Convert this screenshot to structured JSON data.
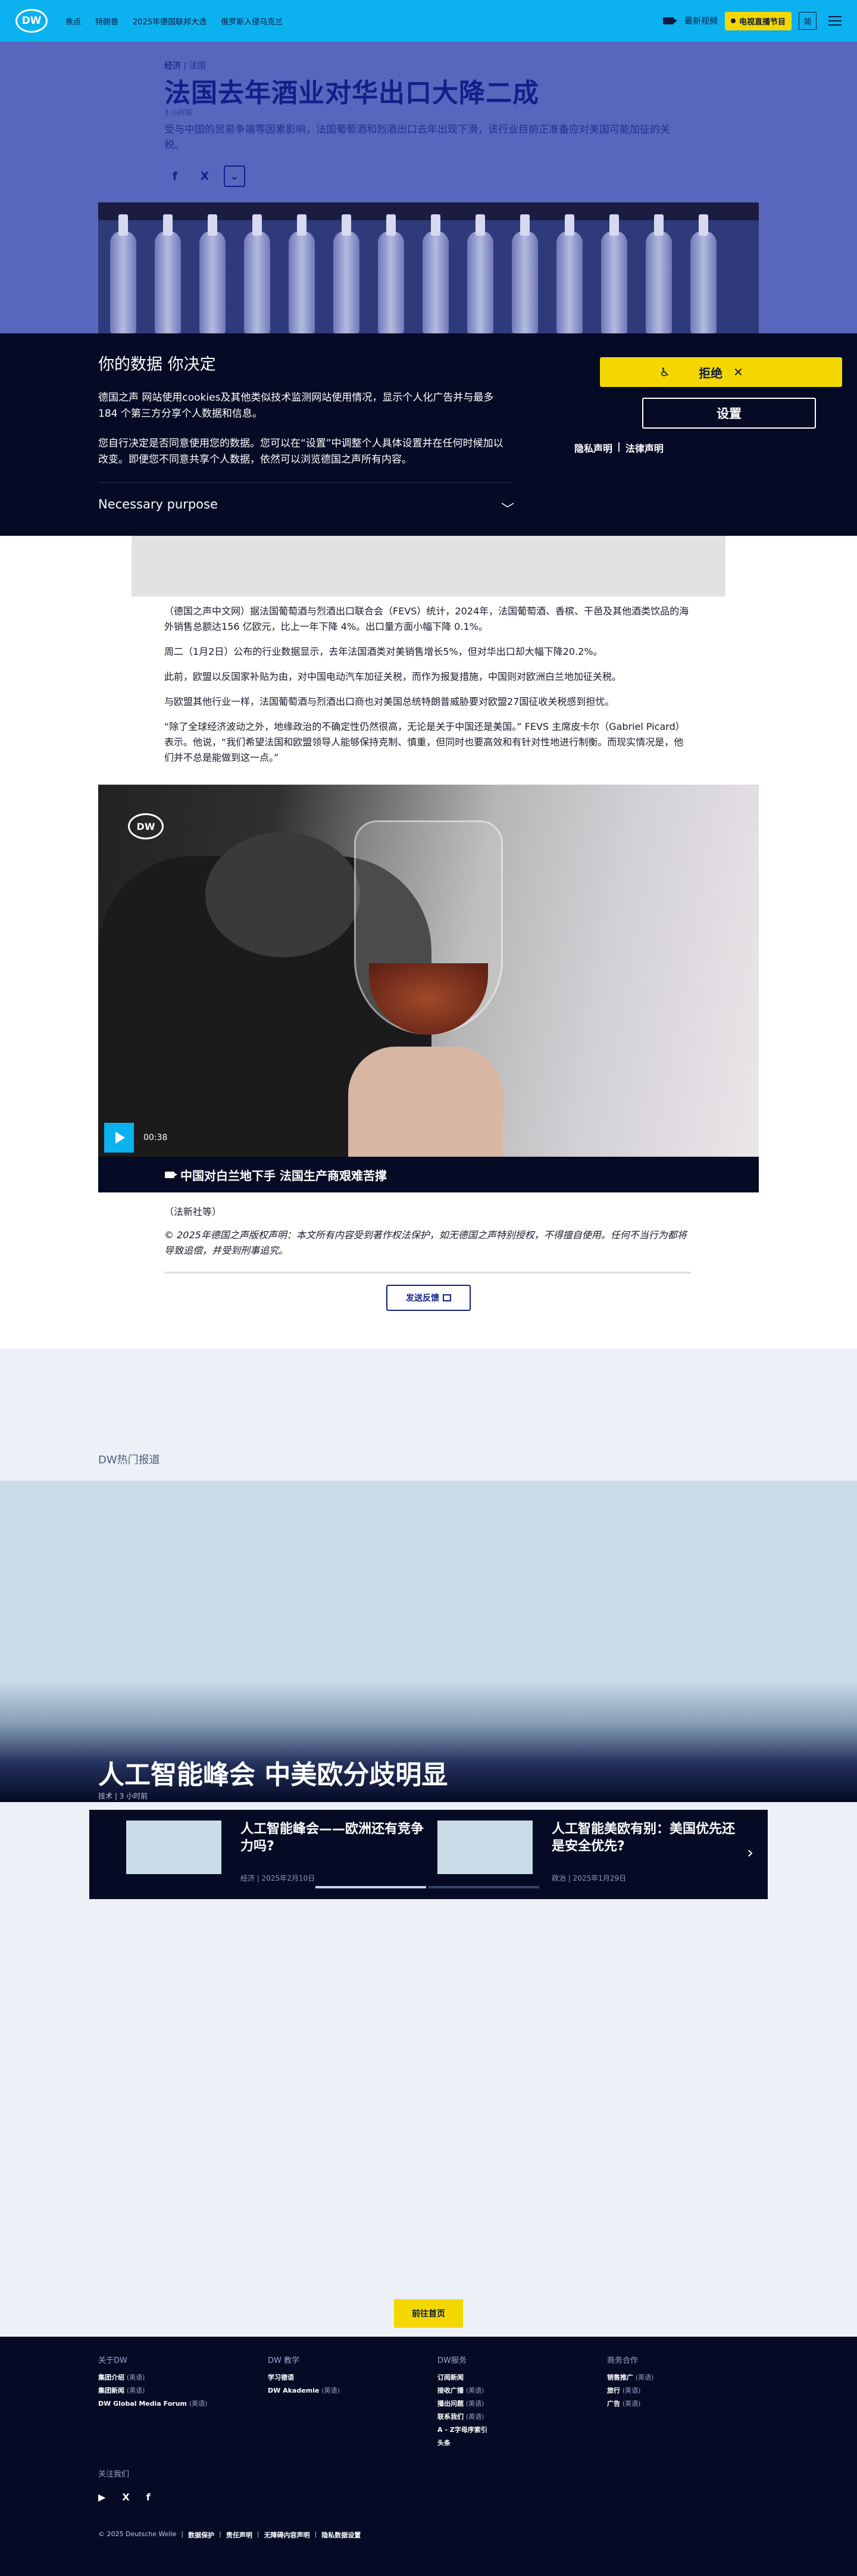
{
  "header": {
    "logo": "DW",
    "nav": [
      "焦点",
      "特朗普",
      "2025年德国联邦大选",
      "俄罗斯入侵乌克兰"
    ],
    "video_label": "最新视频",
    "live_label": "电视直播节目",
    "lang": "简"
  },
  "article": {
    "kicker_cat": "经济",
    "kicker_sub": "法国",
    "title": "法国去年酒业对华出口大降二成",
    "time": "3 小时前",
    "teaser": "受与中国的贸易争端等因素影响，法国葡萄酒和烈酒出口去年出现下滑，该行业目前正准备应对美国可能加征的关税。",
    "share": [
      "f",
      "X"
    ],
    "paragraphs": [
      "（德国之声中文网）据法国葡萄酒与烈酒出口联合会（FEVS）统计，2024年，法国葡萄酒、香槟、干邑及其他酒类饮品的海外销售总额达156 亿欧元，比上一年下降 4%。出口量方面小幅下降 0.1%。",
      "周二（1月2日）公布的行业数据显示，去年法国酒类对美销售增长5%，但对华出口却大幅下降20.2%。",
      "此前，欧盟以反国家补贴为由，对中国电动汽车加征关税，而作为报复措施，中国则对欧洲白兰地加征关税。",
      "与欧盟其他行业一样，法国葡萄酒与烈酒出口商也对美国总统特朗普威胁要对欧盟27国征收关税感到担忧。",
      "“除了全球经济波动之外，地缘政治的不确定性仍然很高，无论是关于中国还是美国。” FEVS 主席皮卡尔（Gabriel Picard）表示。他说，“我们希望法国和欧盟领导人能够保持克制、慎重，但同时也要高效和有针对性地进行制衡。而现实情况是，他们并不总是能做到这一点。”"
    ],
    "source": "（法新社等）",
    "copyright": "© 2025年德国之声版权声明：本文所有内容受到著作权法保护，如无德国之声特别授权，不得擅自使用。任何不当行为都将导致追偿，并受到刑事追究。",
    "feedback": "发送反馈"
  },
  "consent": {
    "heading": "你的数据 你决定",
    "p1": "德国之声 网站使用cookies及其他类似技术监测网站使用情况，显示个人化广告并与最多184 个第三方分享个人数据和信息。",
    "p2": "您自行决定是否同意使用您的数据。您可以在“设置”中调整个人具体设置并在任何时候加以改变。即便您不同意共享个人数据，依然可以浏览德国之声所有内容。",
    "purpose": "Necessary purpose",
    "reject": "拒绝",
    "settings": "设置",
    "privacy": "隐私声明",
    "legal": "法律声明"
  },
  "video": {
    "dw": "DW",
    "time": "00:38",
    "caption": "中国对白兰地下手 法国生产商艰难苦撑"
  },
  "trending": {
    "heading": "DW热门报道",
    "top_title": "人工智能峰会 中美欧分歧明显",
    "top_meta": "技术 | 3 小时前",
    "items": [
      {
        "title": "人工智能峰会——欧洲还有竞争力吗?",
        "meta": "经济 | 2025年2月10日"
      },
      {
        "title": "人工智能美欧有别：美国优先还是安全优先?",
        "meta": "政治 | 2025年1月29日"
      }
    ]
  },
  "homepage_btn": "前往首页",
  "footer": {
    "cols": [
      {
        "h": "关于DW",
        "links": [
          [
            "集团介绍",
            "(英语)"
          ],
          [
            "集团新闻",
            "(英语)"
          ],
          [
            "DW Global Media Forum",
            "(英语)"
          ]
        ]
      },
      {
        "h": "DW 教学",
        "links": [
          [
            "学习德语",
            ""
          ],
          [
            "DW Akademie",
            "(英语)"
          ]
        ]
      },
      {
        "h": "DW服务",
        "links": [
          [
            "订阅新闻",
            ""
          ],
          [
            "接收广播",
            "(英语)"
          ],
          [
            "播出问题",
            "(英语)"
          ],
          [
            "联系我们",
            "(英语)"
          ],
          [
            "A - Z字母序索引",
            ""
          ],
          [
            "头条",
            ""
          ]
        ]
      },
      {
        "h": "商务合作",
        "links": [
          [
            "销售推广",
            "(英语)"
          ],
          [
            "旅行",
            "(英语)"
          ],
          [
            "广告",
            "(英语)"
          ]
        ]
      }
    ],
    "follow": "关注我们",
    "social": [
      "▶",
      "X",
      "f"
    ],
    "legal": [
      "© 2025 Deutsche Welle",
      "数据保护",
      "责任声明",
      "无障碍内容声明",
      "隐私数据设置"
    ]
  }
}
